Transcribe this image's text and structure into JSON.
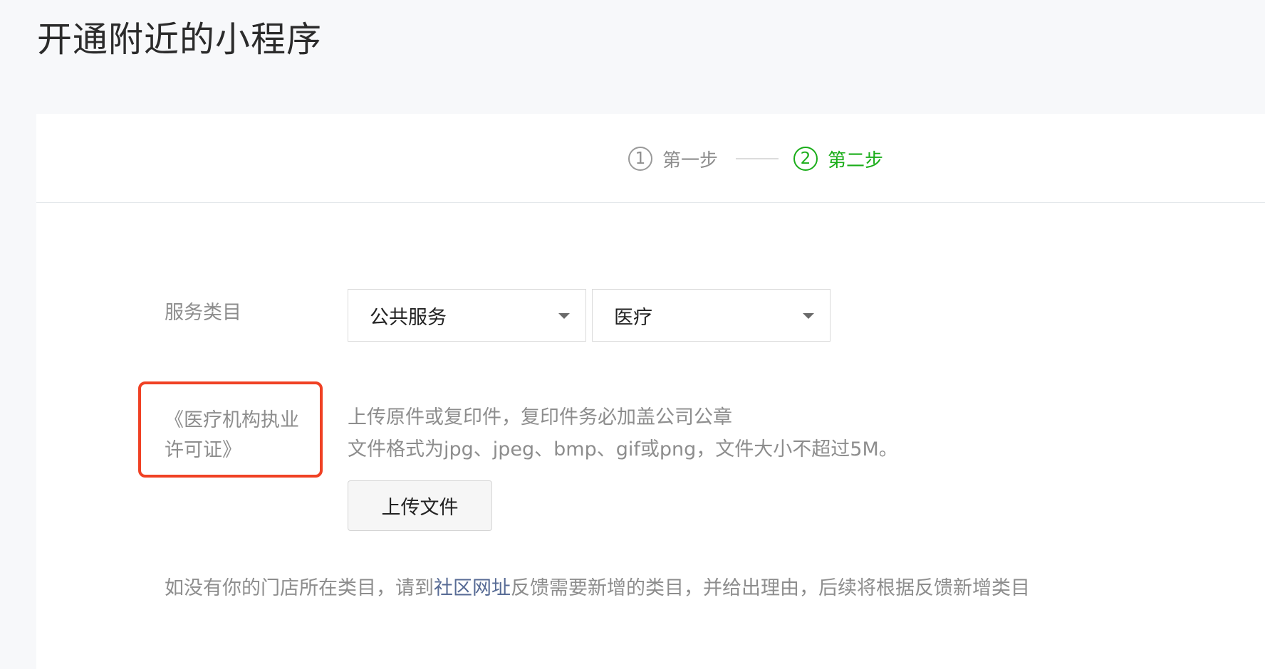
{
  "page": {
    "title": "开通附近的小程序"
  },
  "steps": [
    {
      "number": "1",
      "label": "第一步",
      "active": false
    },
    {
      "number": "2",
      "label": "第二步",
      "active": true
    }
  ],
  "form": {
    "category_label": "服务类目",
    "category_primary": "公共服务",
    "category_secondary": "医疗",
    "license_label": "《医疗机构执业许可证》",
    "upload_tip_1": "上传原件或复印件，复印件务必加盖公司公章",
    "upload_tip_2": "文件格式为jpg、jpeg、bmp、gif或png，文件大小不超过5M。",
    "upload_button": "上传文件"
  },
  "footer": {
    "text_before": "如没有你的门店所在类目，请到",
    "link_text": "社区网址",
    "text_after": "反馈需要新增的类目，并给出理由，后续将根据反馈新增类目"
  },
  "colors": {
    "accent_green": "#1aad19",
    "highlight_red": "#f04124",
    "link_blue": "#576b95"
  },
  "icons": {
    "dropdown": "caret-down-icon"
  }
}
